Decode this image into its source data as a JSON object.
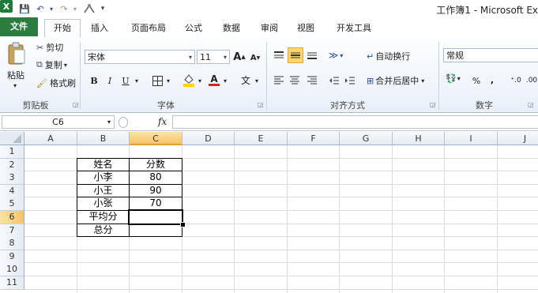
{
  "window": {
    "title": "工作簿1 - Microsoft Ex"
  },
  "qat": {
    "excel_icon": "X",
    "save": "💾",
    "undo": "↶",
    "redo": "↷",
    "customize": "▾"
  },
  "tabs": [
    "文件",
    "开始",
    "插入",
    "页面布局",
    "公式",
    "数据",
    "审阅",
    "视图",
    "开发工具"
  ],
  "clipboard": {
    "paste": "粘贴",
    "cut": "剪切",
    "copy": "复制",
    "format_painter": "格式刷",
    "group": "剪贴板"
  },
  "font": {
    "name": "宋体",
    "size": "11",
    "grow": "A",
    "shrink": "A",
    "bold": "B",
    "italic": "I",
    "underline": "U",
    "phonetic": "文",
    "group": "字体"
  },
  "alignment": {
    "wrap": "自动换行",
    "merge": "合并后居中",
    "group": "对齐方式"
  },
  "number": {
    "format": "常规",
    "percent": "%",
    "comma": ",",
    "group": "数字"
  },
  "formula_bar": {
    "name_box": "C6",
    "fx": "fx",
    "value": ""
  },
  "columns": [
    "A",
    "B",
    "C",
    "D",
    "E",
    "F",
    "G",
    "H",
    "I",
    "J"
  ],
  "selected_column": "C",
  "rows": [
    "1",
    "2",
    "3",
    "4",
    "5",
    "6",
    "7",
    "8",
    "9",
    "10",
    "11"
  ],
  "selected_row": "6",
  "table": {
    "header": [
      "姓名",
      "分数"
    ],
    "rows": [
      [
        "小李",
        "80"
      ],
      [
        "小王",
        "90"
      ],
      [
        "小张",
        "70"
      ],
      [
        "平均分",
        ""
      ],
      [
        "总分",
        ""
      ]
    ]
  }
}
